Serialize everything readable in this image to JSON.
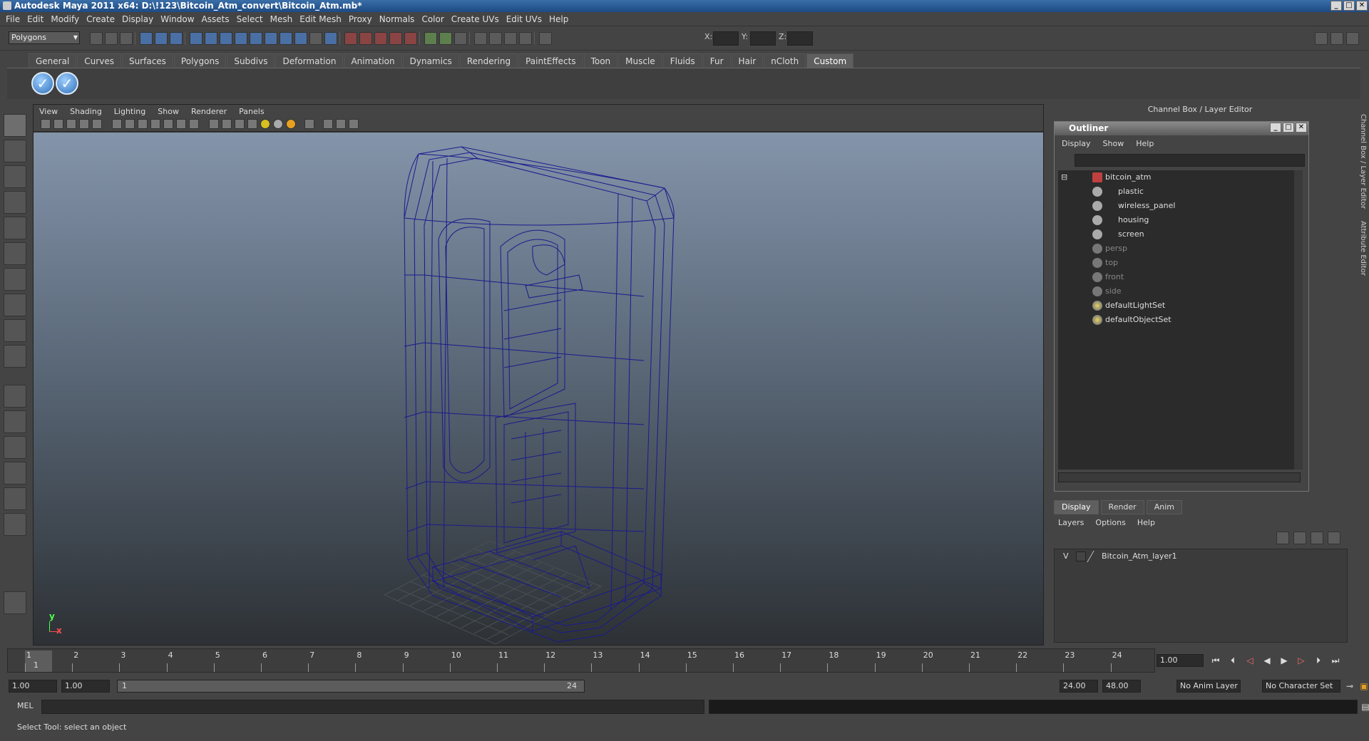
{
  "window": {
    "title": "Autodesk Maya 2011 x64: D:\\!123\\Bitcoin_Atm_convert\\Bitcoin_Atm.mb*"
  },
  "menubar": [
    "File",
    "Edit",
    "Modify",
    "Create",
    "Display",
    "Window",
    "Assets",
    "Select",
    "Mesh",
    "Edit Mesh",
    "Proxy",
    "Normals",
    "Color",
    "Create UVs",
    "Edit UVs",
    "Help"
  ],
  "status": {
    "mode": "Polygons",
    "x_label": "X:",
    "y_label": "Y:",
    "z_label": "Z:"
  },
  "shelf": {
    "tabs": [
      "General",
      "Curves",
      "Surfaces",
      "Polygons",
      "Subdivs",
      "Deformation",
      "Animation",
      "Dynamics",
      "Rendering",
      "PaintEffects",
      "Toon",
      "Muscle",
      "Fluids",
      "Fur",
      "Hair",
      "nCloth",
      "Custom"
    ],
    "active_tab": "Custom"
  },
  "viewport": {
    "menu": [
      "View",
      "Shading",
      "Lighting",
      "Show",
      "Renderer",
      "Panels"
    ],
    "axis_y": "y",
    "axis_x": "x"
  },
  "channel_box": {
    "title": "Channel Box / Layer Editor"
  },
  "outliner": {
    "title": "Outliner",
    "menu": [
      "Display",
      "Show",
      "Help"
    ],
    "items": [
      {
        "label": "bitcoin_atm",
        "level": 0,
        "type": "group"
      },
      {
        "label": "plastic",
        "level": 1,
        "type": "mesh"
      },
      {
        "label": "wireless_panel",
        "level": 1,
        "type": "mesh"
      },
      {
        "label": "housing",
        "level": 1,
        "type": "mesh"
      },
      {
        "label": "screen",
        "level": 1,
        "type": "mesh"
      },
      {
        "label": "persp",
        "level": 0,
        "type": "camera"
      },
      {
        "label": "top",
        "level": 0,
        "type": "camera"
      },
      {
        "label": "front",
        "level": 0,
        "type": "camera"
      },
      {
        "label": "side",
        "level": 0,
        "type": "camera"
      },
      {
        "label": "defaultLightSet",
        "level": 0,
        "type": "set"
      },
      {
        "label": "defaultObjectSet",
        "level": 0,
        "type": "set"
      }
    ]
  },
  "layer_editor": {
    "tabs": [
      "Display",
      "Render",
      "Anim"
    ],
    "active_tab": "Display",
    "menu": [
      "Layers",
      "Options",
      "Help"
    ],
    "layers": [
      {
        "visible": "V",
        "name": "Bitcoin_Atm_layer1"
      }
    ]
  },
  "side_tabs": [
    "Channel Box / Layer Editor",
    "Attribute Editor"
  ],
  "timeline": {
    "ticks": [
      "1",
      "2",
      "3",
      "4",
      "5",
      "6",
      "7",
      "8",
      "9",
      "10",
      "11",
      "12",
      "13",
      "14",
      "15",
      "16",
      "17",
      "18",
      "19",
      "20",
      "21",
      "22",
      "23",
      "24"
    ],
    "current": "1",
    "current_field": "1.00"
  },
  "range": {
    "start": "1.00",
    "start_inner": "1.00",
    "slider_start": "1",
    "slider_end": "24",
    "end_inner": "24.00",
    "end": "48.00",
    "anim_layer": "No Anim Layer",
    "char_set": "No Character Set"
  },
  "command": {
    "label": "MEL"
  },
  "help_line": "Select Tool: select an object"
}
